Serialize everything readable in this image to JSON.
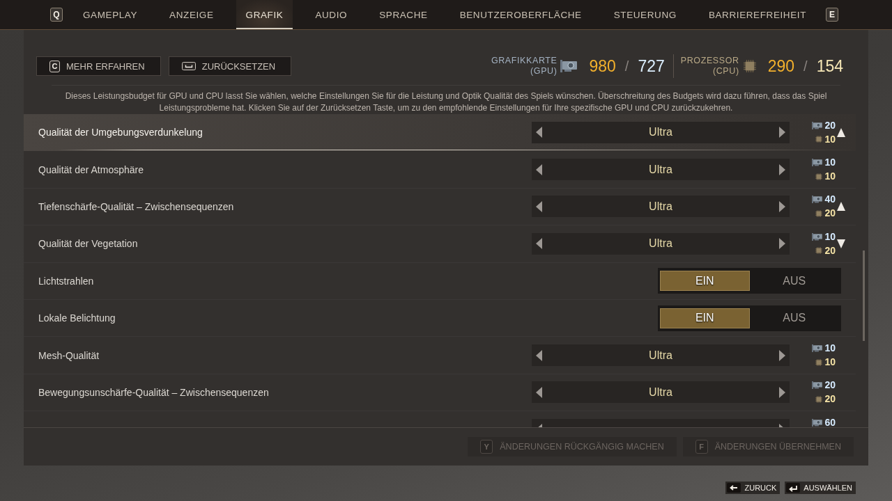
{
  "tab_bar": {
    "prev_key": "Q",
    "tabs": [
      {
        "label": "GAMEPLAY",
        "selected": false
      },
      {
        "label": "ANZEIGE",
        "selected": false
      },
      {
        "label": "GRAFIK",
        "selected": true
      },
      {
        "label": "AUDIO",
        "selected": false
      },
      {
        "label": "SPRACHE",
        "selected": false
      },
      {
        "label": "BENUTZEROBERFLÄCHE",
        "selected": false
      },
      {
        "label": "STEUERUNG",
        "selected": false
      },
      {
        "label": "BARRIEREFREIHEIT",
        "selected": false
      }
    ],
    "next_key": "E"
  },
  "header": {
    "buttons": [
      {
        "kind": "letter",
        "key": "C",
        "label": "MEHR ERFAHREN"
      },
      {
        "kind": "space",
        "label": "ZURÜCKSETZEN"
      }
    ],
    "budget": [
      {
        "kind": "gpu",
        "label": "GRAFIKKARTE",
        "sublabel": "(GPU)",
        "used": "980",
        "separator": "/",
        "limit": "727"
      },
      {
        "kind": "cpu",
        "label": "PROZESSOR",
        "sublabel": "(CPU)",
        "used": "290",
        "separator": "/",
        "limit": "154"
      }
    ],
    "description": "Dieses Leistungsbudget für GPU und CPU lasst Sie wählen, welche Einstellungen Sie für die Leistung und Optik Qualität des Spiels wünschen. Überschreitung des Budgets wird dazu führen, dass das Spiel Leistungsprobleme hat. Klicken Sie auf der Zurücksetzen Taste, um zu den empfohlende Einstellungen für Ihre spezifische GPU und CPU zurückzukehren."
  },
  "rows": [
    {
      "kind": "selector",
      "label": "Qualität der Umgebungsverdunkelung",
      "value": "Ultra",
      "gpu": "20",
      "cpu": "10",
      "arrow": {
        "kind": "up"
      },
      "selected": true
    },
    {
      "kind": "selector",
      "label": "Qualität der Atmosphäre",
      "value": "Ultra",
      "gpu": "10",
      "cpu": "10",
      "selected": false
    },
    {
      "kind": "selector",
      "label": "Tiefenschärfe-Qualität – Zwischensequenzen",
      "value": "Ultra",
      "gpu": "40",
      "cpu": "20",
      "arrow": {
        "kind": "up"
      },
      "selected": false
    },
    {
      "kind": "selector",
      "label": "Qualität der Vegetation",
      "value": "Ultra",
      "gpu": "10",
      "cpu": "20",
      "arrow": {
        "kind": "down"
      },
      "selected": false
    },
    {
      "kind": "toggle",
      "label": "Lichtstrahlen",
      "options": [
        {
          "label": "EIN",
          "selected": true
        },
        {
          "label": "AUS",
          "selected": false
        }
      ],
      "selected": false
    },
    {
      "kind": "toggle",
      "label": "Lokale Belichtung",
      "options": [
        {
          "label": "EIN",
          "selected": true
        },
        {
          "label": "AUS",
          "selected": false
        }
      ],
      "selected": false
    },
    {
      "kind": "selector",
      "label": "Mesh-Qualität",
      "value": "Ultra",
      "gpu": "10",
      "cpu": "10",
      "selected": false
    },
    {
      "kind": "selector",
      "label": "Bewegungsunschärfe-Qualität – Zwischensequenzen",
      "value": "Ultra",
      "gpu": "20",
      "cpu": "20",
      "selected": false
    },
    {
      "kind": "selector",
      "gpu": "60",
      "selected": false
    }
  ],
  "footer_buttons": [
    {
      "key": "Y",
      "label": "ÄNDERUNGEN RÜCKGÄNGIG MACHEN",
      "disabled": true
    },
    {
      "key": "F",
      "label": "ÄNDERUNGEN ÜBERNEHMEN",
      "disabled": true
    }
  ],
  "hints": [
    {
      "kind": "back",
      "label": "ZURUCK"
    },
    {
      "kind": "enter",
      "label": "AUSWÄHLEN"
    }
  ]
}
